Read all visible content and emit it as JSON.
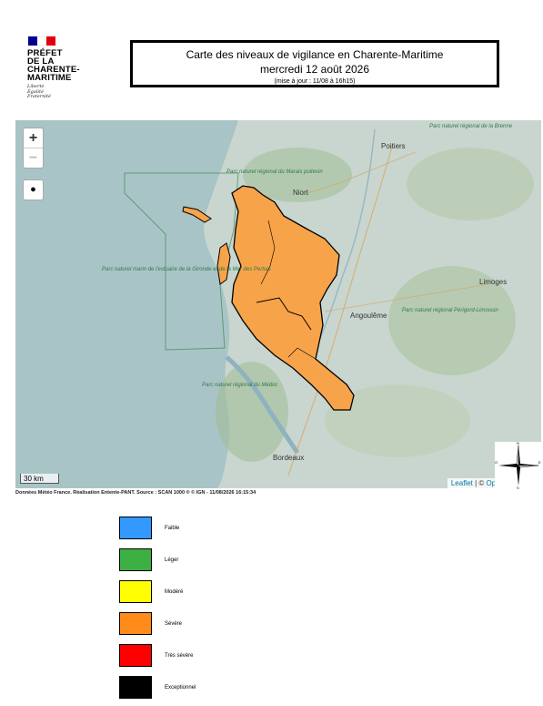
{
  "logo": {
    "line1": "PRÉFET",
    "line2": "DE LA",
    "line3": "CHARENTE-",
    "line4": "MARITIME",
    "motto1": "Liberté",
    "motto2": "Égalité",
    "motto3": "Fraternité",
    "colors": [
      "#000091",
      "#ffffff",
      "#e1000f"
    ]
  },
  "title": {
    "line1": "Carte des niveaux de vigilance en Charente-Maritime",
    "line2": "mercredi 12 août 2026",
    "line3": "(mise à jour : 11/08 à 16h15)"
  },
  "map": {
    "zoom_in": "+",
    "zoom_out": "−",
    "locate_icon": "globe-icon",
    "scale": "30 km",
    "attribution_leaflet": "Leaflet",
    "attribution_sep": " | © ",
    "attribution_osm": "OpenStreetMap",
    "department_color": "#f7a34a",
    "department_level": "Sévère",
    "places": {
      "poitiers": "Poitiers",
      "niort": "Niort",
      "angouleme": "Angoulême",
      "limoges": "Limoges",
      "bordeaux": "Bordeaux",
      "parc_poitevin": "Parc naturel régional du Marais poitevin",
      "parc_brenne": "Parc naturel régional de la Brenne",
      "parc_gironde": "Parc naturel marin de l'estuaire de la Gironde et de la Mer des Pertuis",
      "parc_limousin": "Parc naturel régional Périgord-Limousin",
      "parc_medoc": "Parc naturel régional du Médoc"
    },
    "compass_labels": [
      "N",
      "S",
      "E",
      "O"
    ]
  },
  "credit": "Données Météo France. Réalisation Entente-PANT. Source : SCAN 1000 ® © IGN - 11/08/2026 16:15:34",
  "legend": [
    {
      "label": "Faible",
      "color": "#3399ff"
    },
    {
      "label": "Léger",
      "color": "#3cb043"
    },
    {
      "label": "Modéré",
      "color": "#ffff00"
    },
    {
      "label": "Sévère",
      "color": "#ff8c1a"
    },
    {
      "label": "Très sévère",
      "color": "#ff0000"
    },
    {
      "label": "Exceptionnel",
      "color": "#000000"
    }
  ]
}
